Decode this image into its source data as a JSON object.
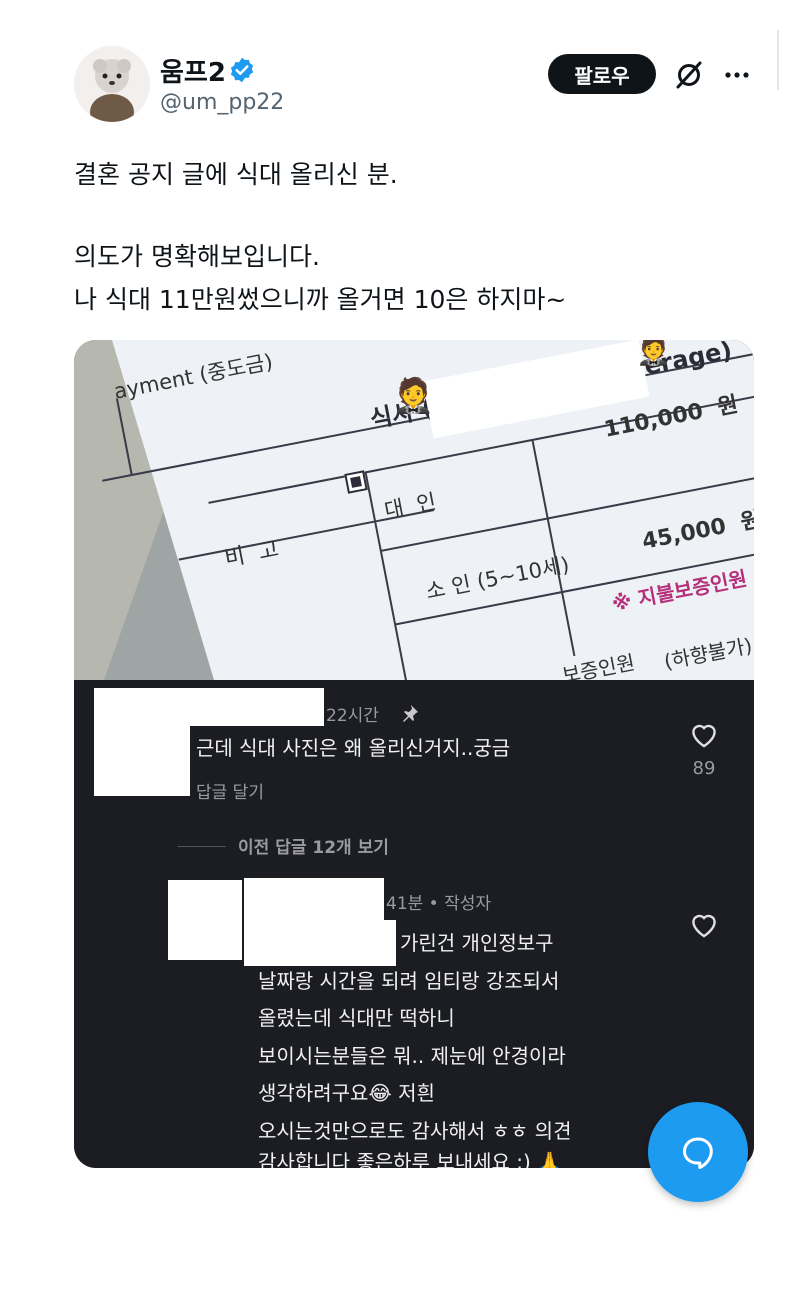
{
  "author": {
    "display_name": "움프2",
    "handle": "@um_pp22",
    "follow_label": "팔로우"
  },
  "tweet": {
    "lines": [
      "결혼 공지 글에 식대 올리신 분.",
      "의도가 명확해보입니다.",
      "나 식대 11만원썼으니까 올거면 10은 하지마~"
    ]
  },
  "photo": {
    "payment_label": "ayment (중도금)",
    "food_header": "식사 (Food) / 음료 (Beverage)",
    "remark_label": "비  고",
    "adult_label": "대  인",
    "child_label": "소 인 (5~10세)",
    "adult_price": "110,000  원",
    "child_price": "45,000  원",
    "guarantee_note": "※ 지불보증인원",
    "lower_note": "(하향불가)",
    "cut_label": "보증인원",
    "emoji_man": "🤵",
    "emoji_corner": "🤵"
  },
  "comments": [
    {
      "time": "22시간",
      "pin_icon": "pin-icon",
      "text": "근데 식대 사진은 왜 올리신거지..궁금",
      "reply_label": "답글 달기",
      "likes": "89"
    },
    {
      "view_replies": "이전 답글 12개 보기"
    },
    {
      "time": "41분 • 작성자",
      "lines": [
        "가린건 개인정보구",
        "날짜랑 시간을 되려 임티랑 강조되서",
        "올렸는데 식대만 떡하니",
        "보이시는분들은 뭐.. 제눈에 안경이라",
        "생각하려구요😂 저흰",
        "오시는것만으로도 감사해서 ㅎㅎ 의견",
        "감사합니다 좋은하루 보내세요 :) 🙏"
      ]
    }
  ],
  "colors": {
    "accent": "#1d9bf0",
    "comment_bg": "#1c1d22"
  }
}
